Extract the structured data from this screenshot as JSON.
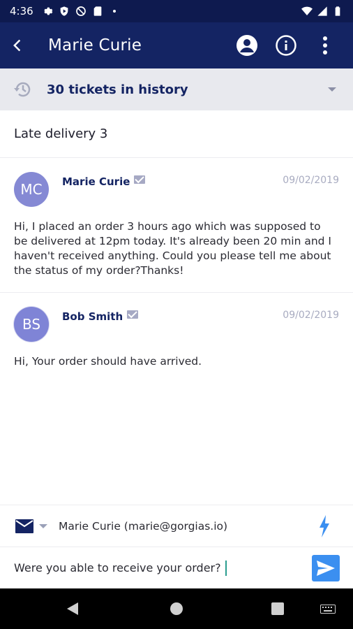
{
  "status_bar": {
    "time": "4:36",
    "left_icons": [
      "settings-icon",
      "play-protect-icon",
      "no-sync-icon",
      "sd-card-icon",
      "dot-icon"
    ],
    "right_icons": [
      "wifi-icon",
      "signal-icon",
      "battery-icon"
    ]
  },
  "app_bar": {
    "title": "Marie Curie",
    "actions": [
      "profile-icon",
      "info-icon",
      "more-vert-icon"
    ]
  },
  "history": {
    "label": "30 tickets in history"
  },
  "ticket": {
    "subject": "Late delivery 3"
  },
  "messages": [
    {
      "initials": "MC",
      "sender": "Marie Curie",
      "date": "09/02/2019",
      "body": "Hi, I placed an order 3 hours ago which was supposed to be delivered at 12pm today. It's already been 20 min and I haven't received anything. Could you please tell me about the status of my order?Thanks!"
    },
    {
      "initials": "BS",
      "sender": "Bob Smith",
      "date": "09/02/2019",
      "body": "Hi, Your order should have arrived."
    }
  ],
  "composer": {
    "recipient": "Marie Curie (marie@gorgias.io)",
    "reply_text": "Were you able to receive your order?"
  },
  "colors": {
    "status_bar": "#0e1a4f",
    "app_bar": "#142463",
    "avatar": "#8589d4",
    "send_button": "#3b8ff0",
    "accent_text": "#142463"
  }
}
